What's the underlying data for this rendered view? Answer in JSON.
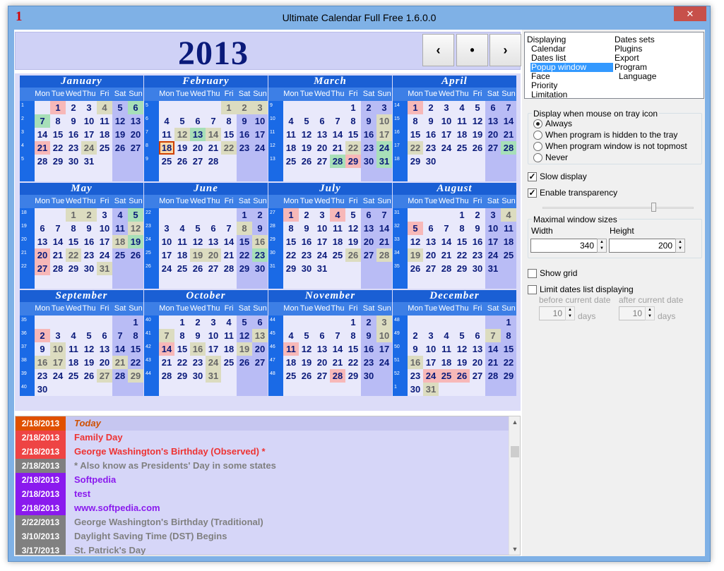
{
  "window": {
    "title": "Ultimate Calendar Full Free 1.6.0.0",
    "icon_label": "1",
    "close_label": "✕"
  },
  "header": {
    "year": "2013",
    "prev_label": "‹",
    "today_label": "•",
    "next_label": "›"
  },
  "day_headers": [
    "Mon",
    "Tue",
    "Wed",
    "Thu",
    "Fri",
    "Sat",
    "Sun"
  ],
  "months": [
    {
      "name": "January",
      "start": 1,
      "days": 31,
      "weeks": [
        "1",
        "2",
        "3",
        "4",
        "5"
      ],
      "marks": {
        "1": "hol",
        "4": "sp",
        "6": "gr",
        "7": "gr",
        "21": "hol",
        "24": "sp"
      }
    },
    {
      "name": "February",
      "start": 4,
      "days": 28,
      "weeks": [
        "5",
        "6",
        "7",
        "8",
        "9"
      ],
      "marks": {
        "1": "sp",
        "2": "sp",
        "3": "sp",
        "12": "sp",
        "13": "gr",
        "14": "sp",
        "18": "today",
        "22": "sp"
      }
    },
    {
      "name": "March",
      "start": 4,
      "days": 31,
      "weeks": [
        "9",
        "10",
        "11",
        "12",
        "13"
      ],
      "marks": {
        "10": "sp",
        "17": "sp",
        "22": "sp",
        "24": "gr",
        "28": "gr",
        "29": "hol",
        "31": "gr"
      }
    },
    {
      "name": "April",
      "start": 0,
      "days": 30,
      "weeks": [
        "14",
        "15",
        "16",
        "17",
        "18"
      ],
      "marks": {
        "1": "hol",
        "22": "sp",
        "28": "gr"
      }
    },
    {
      "name": "May",
      "start": 2,
      "days": 31,
      "weeks": [
        "18",
        "19",
        "20",
        "21",
        "22"
      ],
      "marks": {
        "1": "sp",
        "2": "sp",
        "5": "gr",
        "12": "sp",
        "18": "sp",
        "19": "gr",
        "20": "hol",
        "22": "sp",
        "27": "hol",
        "31": "sp"
      }
    },
    {
      "name": "June",
      "start": 5,
      "days": 30,
      "weeks": [
        "22",
        "23",
        "24",
        "25",
        "26"
      ],
      "marks": {
        "8": "sp",
        "16": "sp",
        "19": "sp",
        "20": "sp",
        "23": "gr"
      }
    },
    {
      "name": "July",
      "start": 0,
      "days": 31,
      "weeks": [
        "27",
        "28",
        "29",
        "30",
        "31"
      ],
      "marks": {
        "1": "hol",
        "4": "hol",
        "26": "sp",
        "28": "sp"
      }
    },
    {
      "name": "August",
      "start": 3,
      "days": 31,
      "weeks": [
        "31",
        "32",
        "33",
        "34",
        "35"
      ],
      "marks": {
        "4": "sp",
        "5": "hol",
        "19": "sp"
      }
    },
    {
      "name": "September",
      "start": 6,
      "days": 30,
      "weeks": [
        "35",
        "36",
        "37",
        "38",
        "39",
        "40"
      ],
      "marks": {
        "2": "hol",
        "10": "sp",
        "16": "sp",
        "17": "sp",
        "21": "sp",
        "27": "sp",
        "29": "sp"
      }
    },
    {
      "name": "October",
      "start": 1,
      "days": 31,
      "weeks": [
        "40",
        "41",
        "42",
        "43",
        "44"
      ],
      "marks": {
        "7": "sp",
        "13": "sp",
        "14": "hol",
        "16": "sp",
        "19": "sp",
        "24": "sp",
        "31": "sp"
      }
    },
    {
      "name": "November",
      "start": 4,
      "days": 30,
      "weeks": [
        "44",
        "45",
        "46",
        "47",
        "48"
      ],
      "marks": {
        "3": "sp",
        "10": "sp",
        "11": "hol",
        "28": "hol"
      }
    },
    {
      "name": "December",
      "start": 6,
      "days": 31,
      "weeks": [
        "48",
        "49",
        "50",
        "51",
        "52",
        "1"
      ],
      "marks": {
        "7": "sp",
        "16": "sp",
        "24": "hol",
        "25": "hol",
        "26": "hol",
        "31": "sp"
      }
    }
  ],
  "events": [
    {
      "date": "2/18/2013",
      "text": "Today",
      "dcolor": "#e05000",
      "tcolor": "#d05000",
      "bg": "#c6c6f0",
      "italic": true
    },
    {
      "date": "2/18/2013",
      "text": "Family Day",
      "dcolor": "#ee4444",
      "tcolor": "#ee3333",
      "bg": "#d6d6f8",
      "italic": false
    },
    {
      "date": "2/18/2013",
      "text": "George Washington's Birthday (Observed) *",
      "dcolor": "#ee4444",
      "tcolor": "#ee3333",
      "bg": "#d6d6f8",
      "italic": false
    },
    {
      "date": "2/18/2013",
      "text": "* Also know as Presidents' Day in some states",
      "dcolor": "#808080",
      "tcolor": "#808080",
      "bg": "#d6d6f8",
      "italic": false
    },
    {
      "date": "2/18/2013",
      "text": "Softpedia",
      "dcolor": "#8a1aee",
      "tcolor": "#8a1aee",
      "bg": "#d6d6f8",
      "italic": false
    },
    {
      "date": "2/18/2013",
      "text": "test",
      "dcolor": "#8a1aee",
      "tcolor": "#8a1aee",
      "bg": "#d6d6f8",
      "italic": false
    },
    {
      "date": "2/18/2013",
      "text": "www.softpedia.com",
      "dcolor": "#8a1aee",
      "tcolor": "#8a1aee",
      "bg": "#d6d6f8",
      "italic": false
    },
    {
      "date": "2/22/2013",
      "text": "George Washington's Birthday (Traditional)",
      "dcolor": "#808080",
      "tcolor": "#808080",
      "bg": "#d6d6f8",
      "italic": false
    },
    {
      "date": "3/10/2013",
      "text": "Daylight Saving Time (DST) Begins",
      "dcolor": "#808080",
      "tcolor": "#808080",
      "bg": "#d6d6f8",
      "italic": false
    },
    {
      "date": "3/17/2013",
      "text": "St. Patrick's Day",
      "dcolor": "#808080",
      "tcolor": "#808080",
      "bg": "#d6d6f8",
      "italic": false
    }
  ],
  "settings": {
    "nav_left": [
      "Displaying",
      "Calendar",
      "Dates list",
      "Popup window",
      "Face",
      "Priority",
      "Limitation"
    ],
    "nav_right": [
      "Dates sets",
      "Plugins",
      "Export",
      "Program",
      "Language"
    ],
    "tray_group": "Display when mouse on tray icon",
    "tray_options": [
      "Always",
      "When program is hidden to the tray",
      "When program window is not topmost",
      "Never"
    ],
    "slow_display": "Slow display",
    "enable_transparency": "Enable transparency",
    "max_group": "Maximal window sizes",
    "width_label": "Width",
    "height_label": "Height",
    "width_value": "340",
    "height_value": "200",
    "show_grid": "Show grid",
    "limit_dates": "Limit dates list displaying",
    "before_label": "before current date",
    "after_label": "after current date",
    "before_value": "10",
    "after_value": "10",
    "days_label": "days"
  }
}
